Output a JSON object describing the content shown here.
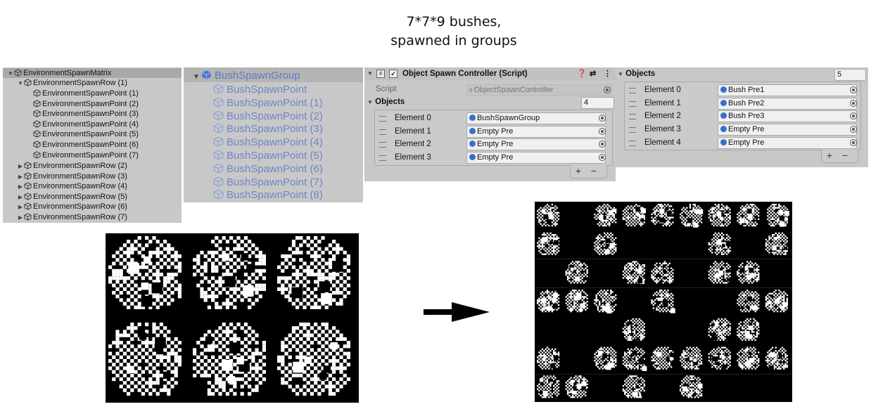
{
  "title": {
    "line1": "7*7*9 bushes,",
    "line2": "spawned in groups"
  },
  "hierarchy": {
    "root": "EnvironmentSpawnMatrix",
    "expanded_row": "EnvironmentSpawnRow (1)",
    "points": [
      "EnvironmentSpawnPoint (1)",
      "EnvironmentSpawnPoint (2)",
      "EnvironmentSpawnPoint (3)",
      "EnvironmentSpawnPoint (4)",
      "EnvironmentSpawnPoint (5)",
      "EnvironmentSpawnPoint (6)",
      "EnvironmentSpawnPoint (7)"
    ],
    "rows": [
      "EnvironmentSpawnRow (2)",
      "EnvironmentSpawnRow (3)",
      "EnvironmentSpawnRow (4)",
      "EnvironmentSpawnRow (5)",
      "EnvironmentSpawnRow (6)",
      "EnvironmentSpawnRow (7)"
    ]
  },
  "bush_group": {
    "root": "BushSpawnGroup",
    "points": [
      "BushSpawnPoint",
      "BushSpawnPoint (1)",
      "BushSpawnPoint (2)",
      "BushSpawnPoint (3)",
      "BushSpawnPoint (4)",
      "BushSpawnPoint (5)",
      "BushSpawnPoint (6)",
      "BushSpawnPoint (7)",
      "BushSpawnPoint (8)"
    ]
  },
  "inspector": {
    "component_title": "Object Spawn Controller (Script)",
    "script_label": "Script",
    "script_value": "ObjectSpawnController",
    "objects_label": "Objects",
    "objects_count": "4",
    "elements": [
      {
        "label": "Element 0",
        "value": "BushSpawnGroup"
      },
      {
        "label": "Element 1",
        "value": "Empty Pre"
      },
      {
        "label": "Element 2",
        "value": "Empty Pre"
      },
      {
        "label": "Element 3",
        "value": "Empty Pre"
      }
    ],
    "plus": "+",
    "minus": "−"
  },
  "objects_panel": {
    "objects_label": "Objects",
    "objects_count": "5",
    "elements": [
      {
        "label": "Element 0",
        "value": "Bush Pre1"
      },
      {
        "label": "Element 1",
        "value": "Bush Pre2"
      },
      {
        "label": "Element 2",
        "value": "Bush Pre3"
      },
      {
        "label": "Element 3",
        "value": "Empty Pre"
      },
      {
        "label": "Element 4",
        "value": "Empty Pre"
      }
    ],
    "plus": "+",
    "minus": "−"
  },
  "right_grid": {
    "rows": [
      [
        1,
        0,
        1,
        1,
        1,
        1,
        1,
        1,
        1
      ],
      [
        1,
        0,
        1,
        0,
        0,
        0,
        1,
        0,
        1
      ],
      [
        0,
        1,
        0,
        1,
        1,
        0,
        1,
        1,
        0
      ],
      [
        1,
        1,
        1,
        0,
        1,
        0,
        0,
        1,
        1
      ],
      [
        0,
        0,
        0,
        1,
        0,
        0,
        1,
        1,
        0
      ],
      [
        1,
        0,
        1,
        1,
        1,
        1,
        1,
        1,
        1
      ],
      [
        1,
        1,
        0,
        1,
        0,
        1,
        0,
        0,
        0
      ]
    ]
  },
  "colors": {
    "panel": "#c8c8c8",
    "bush_text": "#6d86c8",
    "icon_blue": "#3a6fc9"
  }
}
